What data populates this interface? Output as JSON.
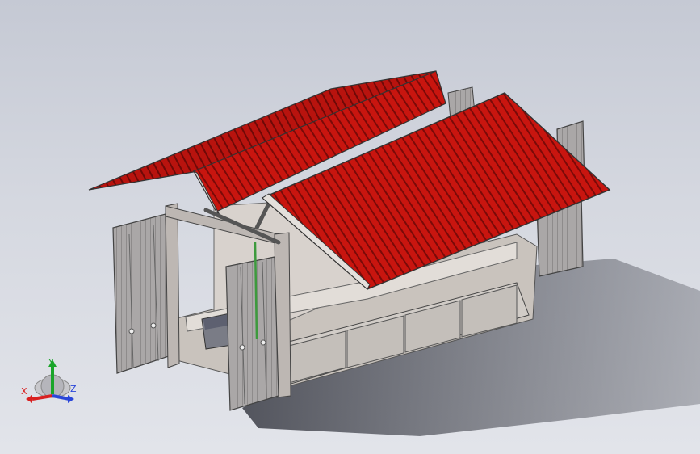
{
  "viewport": {
    "background_top": "#c5c9d4",
    "background_bottom": "#e2e4ea"
  },
  "model": {
    "roof_color": "#c8150f",
    "roof_rib_color": "#7a0a08",
    "frame_color": "#b9b4b1",
    "door_color": "#a9a6a6",
    "floor_color": "#cfcac5",
    "interior_color": "#d8d2cd"
  },
  "triad": {
    "x_label": "X",
    "y_label": "Y",
    "z_label": "Z",
    "x_color": "#d92020",
    "y_color": "#1aa52a",
    "z_color": "#2a46d9"
  }
}
